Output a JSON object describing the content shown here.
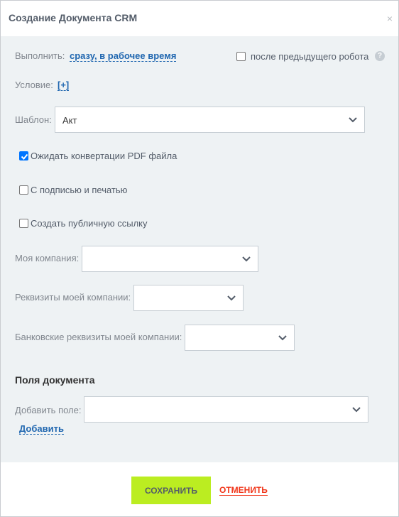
{
  "dialog": {
    "title": "Создание Документа CRM",
    "close_symbol": "×"
  },
  "execute": {
    "label": "Выполнить:",
    "value": "сразу, в рабочее время",
    "after_previous_label": "после предыдущего робота",
    "after_previous_checked": false,
    "help_symbol": "?"
  },
  "condition": {
    "label": "Условие:",
    "add_link": "[+]"
  },
  "template": {
    "label": "Шаблон:",
    "value": "Акт"
  },
  "checkboxes": [
    {
      "label": "Ожидать конвертации PDF файла",
      "checked": true
    },
    {
      "label": "С подписью и печатью",
      "checked": false
    },
    {
      "label": "Создать публичную ссылку",
      "checked": false
    }
  ],
  "my_company": {
    "label": "Моя компания:",
    "value": ""
  },
  "my_company_requisites": {
    "label": "Реквизиты моей компании:",
    "value": ""
  },
  "my_company_bank_requisites": {
    "label": "Банковские реквизиты моей компании:",
    "value": ""
  },
  "document_fields": {
    "title": "Поля документа",
    "add_field_label": "Добавить поле:",
    "add_field_value": "",
    "add_link": "Добавить"
  },
  "footer": {
    "save_label": "СОХРАНИТЬ",
    "cancel_label": "ОТМЕНИТЬ"
  },
  "colors": {
    "accent_link": "#2067b0",
    "save_button": "#bbed21",
    "cancel_link": "#f1361a",
    "checkbox_checked": "#0075ff",
    "body_background": "#eef2f4"
  },
  "icons": {
    "close": "close-icon",
    "help": "help-icon",
    "chevron": "chevron-down-icon",
    "check": "check-icon"
  }
}
